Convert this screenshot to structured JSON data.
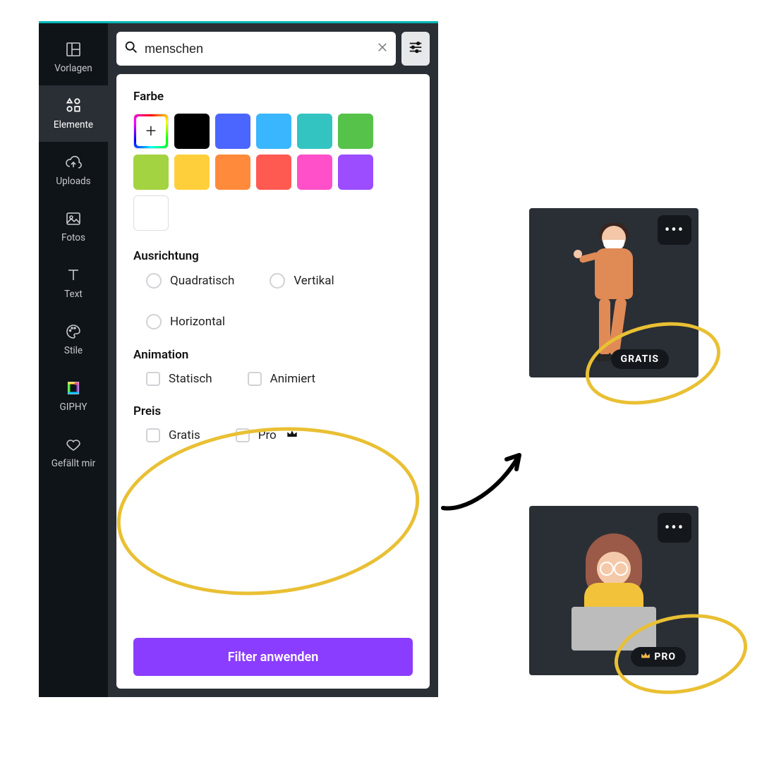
{
  "sidebar": {
    "items": [
      {
        "label": "Vorlagen"
      },
      {
        "label": "Elemente"
      },
      {
        "label": "Uploads"
      },
      {
        "label": "Fotos"
      },
      {
        "label": "Text"
      },
      {
        "label": "Stile"
      },
      {
        "label": "GIPHY"
      },
      {
        "label": "Gefällt mir"
      }
    ]
  },
  "search": {
    "value": "menschen"
  },
  "filters": {
    "color_title": "Farbe",
    "orientation_title": "Ausrichtung",
    "orientation_options": {
      "square": "Quadratisch",
      "vertical": "Vertikal",
      "horizontal": "Horizontal"
    },
    "animation_title": "Animation",
    "animation_options": {
      "static": "Statisch",
      "animated": "Animiert"
    },
    "price_title": "Preis",
    "price_options": {
      "free": "Gratis",
      "pro": "Pro"
    },
    "apply_label": "Filter anwenden",
    "colors": [
      "#000000",
      "#4a66ff",
      "#3ab6ff",
      "#33c4c2",
      "#57c24a",
      "#a3d340",
      "#ffcf3b",
      "#ff8a3b",
      "#ff5a52",
      "#ff4fc9",
      "#9b4dff",
      "#ffffff"
    ]
  },
  "cards": {
    "badge_free": "GRATIS",
    "badge_pro": "PRO",
    "more": "•••"
  }
}
